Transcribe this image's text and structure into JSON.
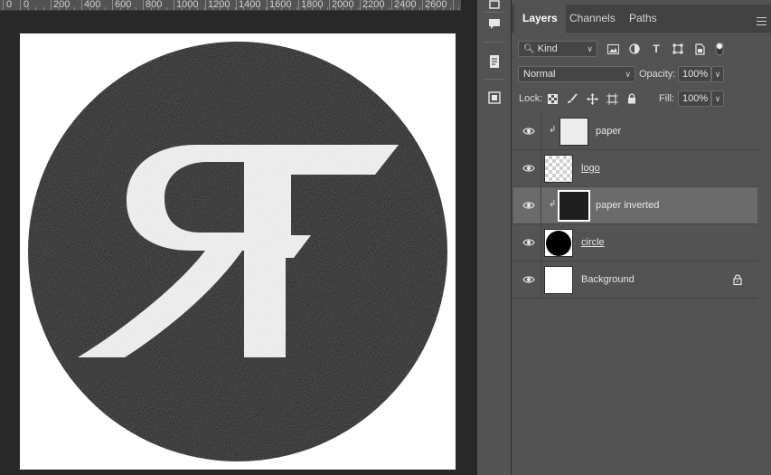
{
  "ruler": {
    "labels": [
      "0",
      "200",
      "400",
      "600",
      "800",
      "1000",
      "1200",
      "1400",
      "1600",
      "1800",
      "2000",
      "2200",
      "2400",
      "2600"
    ]
  },
  "tool_strip": {
    "icons": [
      "history-icon",
      "comments-icon",
      "properties-icon",
      "libraries-icon"
    ]
  },
  "layers_panel": {
    "tabs": [
      {
        "label": "Layers",
        "active": true
      },
      {
        "label": "Channels",
        "active": false
      },
      {
        "label": "Paths",
        "active": false
      }
    ],
    "filter": {
      "value": "Kind"
    },
    "blend_mode": {
      "value": "Normal"
    },
    "opacity": {
      "label": "Opacity:",
      "value": "100%"
    },
    "lock": {
      "label": "Lock:"
    },
    "fill": {
      "label": "Fill:",
      "value": "100%"
    },
    "layers": [
      {
        "name": "paper",
        "thumb": "paper",
        "clipped": true,
        "linked": false,
        "selected": false,
        "locked": false
      },
      {
        "name": "logo",
        "thumb": "checker",
        "clipped": false,
        "linked": true,
        "selected": false,
        "locked": false
      },
      {
        "name": "paper inverted",
        "thumb": "dark",
        "clipped": true,
        "linked": false,
        "selected": true,
        "locked": false
      },
      {
        "name": "circle",
        "thumb": "circle",
        "clipped": false,
        "linked": true,
        "selected": false,
        "locked": false
      },
      {
        "name": "Background",
        "thumb": "white",
        "clipped": false,
        "linked": false,
        "selected": false,
        "locked": true
      }
    ]
  },
  "colors": {
    "panel_bg": "#535353",
    "canvas_bg": "#282828",
    "selected_layer": "#6b6b6b",
    "logo_fill": "#f0f0f0",
    "circle_fill": "#1c1c1c"
  }
}
